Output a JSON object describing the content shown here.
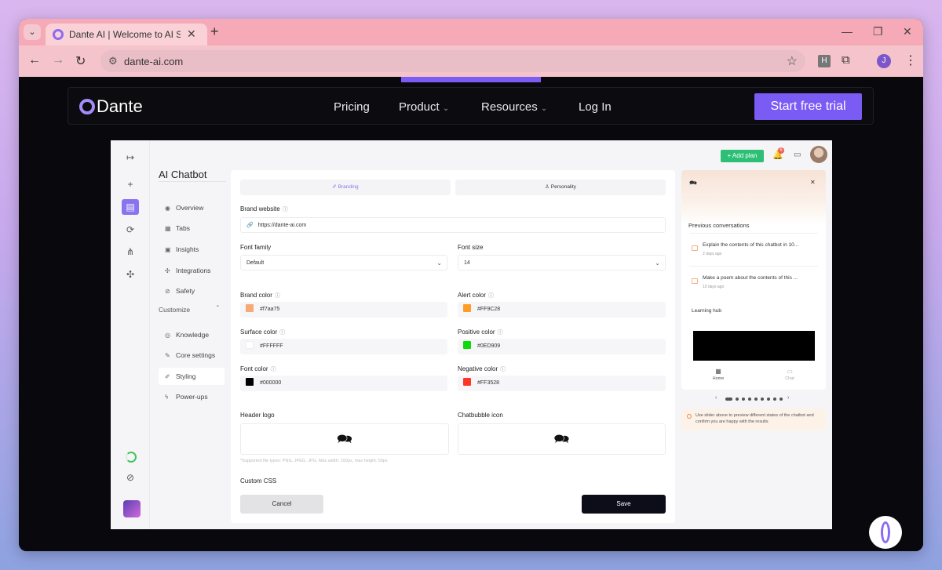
{
  "browser": {
    "tab_title": "Dante AI | Welcome to AI Simpl",
    "url": "dante-ai.com",
    "ext_label": "H",
    "profile_initial": "J"
  },
  "site": {
    "logo_text": "Dante",
    "nav": [
      "Pricing",
      "Product",
      "Resources",
      "Log In"
    ],
    "cta": "Start free trial"
  },
  "app": {
    "top": {
      "add_plan": "+ Add plan",
      "notif_count": "6"
    },
    "sidebar": {
      "title": "AI Chatbot",
      "items": [
        "Overview",
        "Tabs",
        "Insights",
        "Integrations",
        "Safety"
      ],
      "section": "Customize",
      "sub_items": [
        "Knowledge",
        "Core settings",
        "Styling",
        "Power-ups"
      ]
    },
    "form": {
      "tabs": [
        "Branding",
        "Personality"
      ],
      "brand_website_label": "Brand website",
      "brand_website_value": "https://dante-ai.com",
      "font_family_label": "Font family",
      "font_family_value": "Default",
      "font_size_label": "Font size",
      "font_size_value": "14",
      "colors": [
        {
          "label": "Brand color",
          "value": "#f7aa75",
          "swatch": "#f7aa75"
        },
        {
          "label": "Alert color",
          "value": "#FF9C28",
          "swatch": "#FF9C28"
        },
        {
          "label": "Surface color",
          "value": "#FFFFFF",
          "swatch": "#FFFFFF"
        },
        {
          "label": "Positive color",
          "value": "#0ED909",
          "swatch": "#0ED909"
        },
        {
          "label": "Font color",
          "value": "#000000",
          "swatch": "#000000"
        },
        {
          "label": "Negative color",
          "value": "#FF3528",
          "swatch": "#FF3528"
        }
      ],
      "header_logo_label": "Header logo",
      "chatbubble_label": "Chatbubble icon",
      "upload_hint": "*Supported file types: PNG, JPEG, JPG. Max width: 150px, max height: 50px",
      "custom_css_label": "Custom CSS",
      "cancel": "Cancel",
      "save": "Save"
    },
    "preview": {
      "title": "Previous conversations",
      "conversations": [
        {
          "text": "Explain the contents of this chatbot in 10...",
          "date": "2 days ago"
        },
        {
          "text": "Make a poem about the contents of this ...",
          "date": "10 days ago"
        }
      ],
      "hub_title": "Learning hub",
      "nav": [
        "Home",
        "Chat"
      ],
      "note": "Use slider above to preview different states of the chatbot and confirm you are happy with the results"
    }
  }
}
